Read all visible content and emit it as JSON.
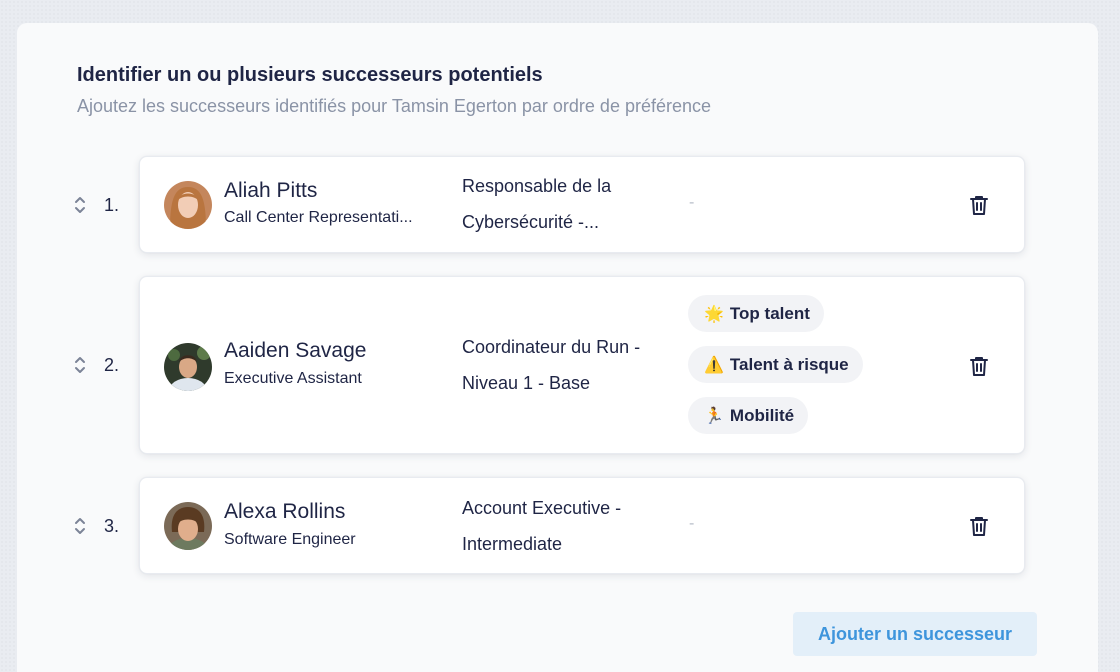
{
  "section": {
    "title": "Identifier un ou plusieurs successeurs potentiels",
    "subtitle": "Ajoutez les successeurs identifiés pour Tamsin Egerton par ordre de préférence"
  },
  "successors": [
    {
      "rank": "1.",
      "name": "Aliah Pitts",
      "role": "Call Center Representati...",
      "position_line1": "Responsable de la",
      "position_line2": "Cybersécurité -...",
      "tags_placeholder": "-"
    },
    {
      "rank": "2.",
      "name": "Aaiden Savage",
      "role": "Executive Assistant",
      "position_line1": "Coordinateur du Run -",
      "position_line2": "Niveau 1 - Base",
      "tags": [
        {
          "emoji": "🌟",
          "label": "Top talent"
        },
        {
          "emoji": "⚠️",
          "label": "Talent à risque"
        },
        {
          "emoji": "🏃",
          "label": "Mobilité"
        }
      ]
    },
    {
      "rank": "3.",
      "name": "Alexa Rollins",
      "role": "Software Engineer",
      "position_line1": "Account Executive -",
      "position_line2": "Intermediate",
      "tags_placeholder": "-"
    }
  ],
  "actions": {
    "add_successor": "Ajouter un successeur"
  },
  "icons": {
    "drag": "drag-handle-icon",
    "delete": "trash-icon"
  },
  "colors": {
    "text_primary": "#1f2545",
    "text_muted": "#8a93a6",
    "accent": "#3e95dc",
    "accent_bg": "#e3eff9"
  }
}
